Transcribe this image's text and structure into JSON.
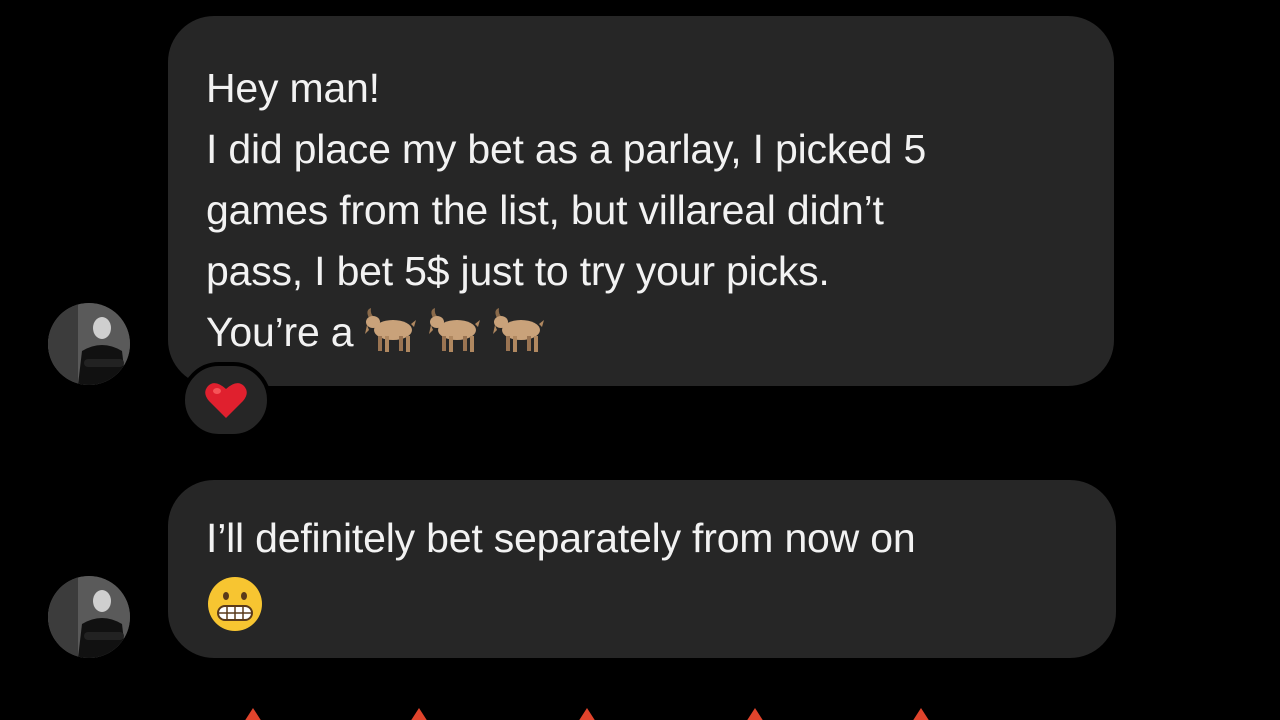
{
  "messages": [
    {
      "lines": [
        "Hey man!",
        "I did place my bet as a parlay, I picked 5",
        "games from the list, but villareal didn’t",
        "pass, I bet 5$ just to try your picks.",
        "You’re a"
      ],
      "trailing_emoji": [
        "goat-emoji",
        "goat-emoji",
        "goat-emoji"
      ],
      "reaction": "red-heart-emoji"
    },
    {
      "lines": [
        "I’ll definitely bet separately from now on"
      ],
      "trailing_emoji": [
        "grimacing-face-emoji"
      ]
    }
  ],
  "colors": {
    "background": "#000000",
    "bubble": "#262626",
    "text": "#f2f2f2",
    "heart": "#e0202e",
    "accent_arrows": "#e0442c"
  }
}
